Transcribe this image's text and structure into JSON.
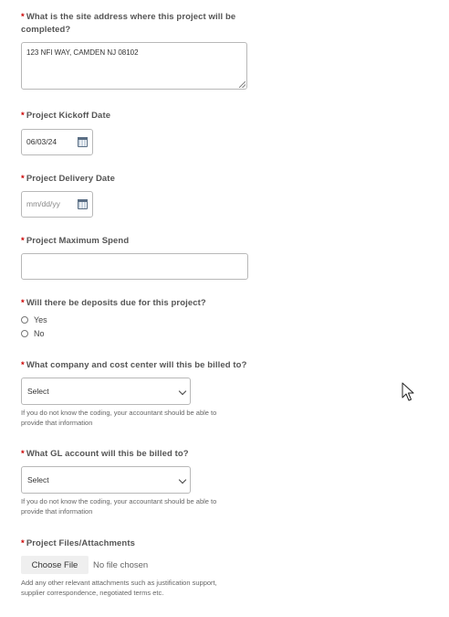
{
  "site_address": {
    "label_line1": "What is the site address where this project will be",
    "label_line2": "completed?",
    "value": "123 NFI WAY, CAMDEN NJ 08102"
  },
  "kickoff_date": {
    "label": "Project Kickoff Date",
    "value": "06/03/24"
  },
  "delivery_date": {
    "label": "Project Delivery Date",
    "placeholder": "mm/dd/yy"
  },
  "max_spend": {
    "label": "Project Maximum Spend",
    "value": ""
  },
  "deposits": {
    "label": "Will there be deposits due for this project?",
    "options": [
      "Yes",
      "No"
    ]
  },
  "cost_center": {
    "label": "What company and cost center will this be billed to?",
    "selected": "Select",
    "help_line1": "If you do not know the coding, your accountant should be able to",
    "help_line2": "provide that information"
  },
  "gl_account": {
    "label": "What GL account will this be billed to?",
    "selected": "Select",
    "help_line1": "If you do not know the coding, your accountant should be able to",
    "help_line2": "provide that information"
  },
  "attachments": {
    "label": "Project Files/Attachments",
    "button_label": "Choose File",
    "status": "No file chosen",
    "help_line1": "Add any other relevant attachments such as justification support,",
    "help_line2": "supplier correspondence, negotiated terms etc."
  },
  "required_marker": "*",
  "icons": {
    "calendar": "calendar-icon",
    "dropdown": "chevron-down-icon",
    "cursor": "mouse-pointer-icon"
  }
}
